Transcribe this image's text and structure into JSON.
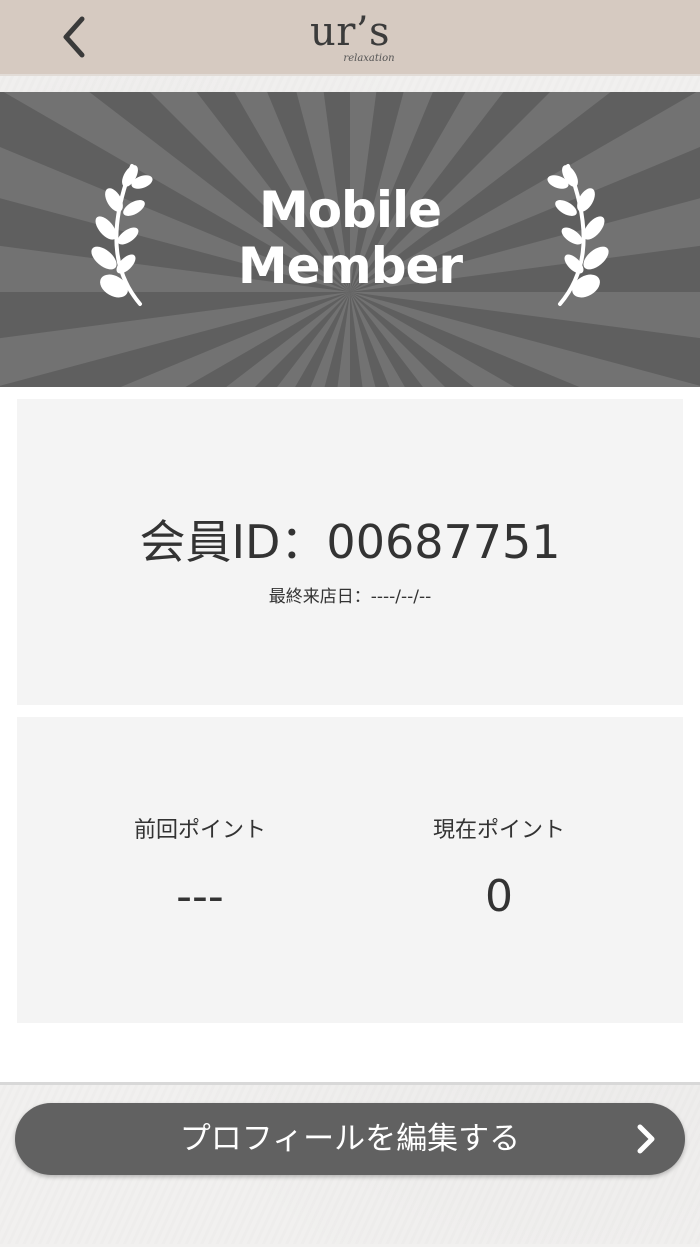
{
  "header": {
    "back_icon": "chevron-left-icon",
    "logo_text": "ur’s",
    "logo_subtext": "relaxation",
    "color": "#d6cac1"
  },
  "banner": {
    "title_line1": "Mobile",
    "title_line2": "Member",
    "decoration_icon": "laurel-branch-icon",
    "background_color": "#5f5f5f"
  },
  "member": {
    "id_line": "会員ID：00687751",
    "last_visit_line": "最終来店日：----/--/--"
  },
  "points": {
    "previous_label": "前回ポイント",
    "previous_value": "---",
    "current_label": "現在ポイント",
    "current_value": "0"
  },
  "footer": {
    "edit_profile_label": "プロフィールを編集する",
    "chevron_icon": "chevron-right-icon",
    "button_color": "#616161"
  }
}
